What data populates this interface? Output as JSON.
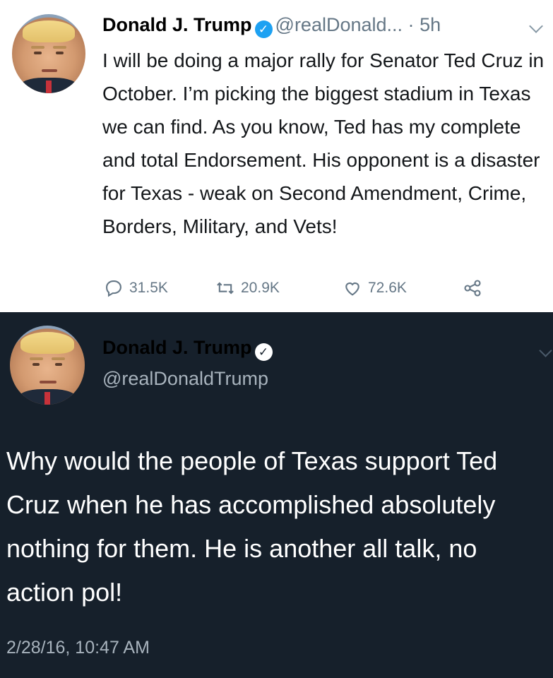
{
  "tweet1": {
    "author_name": "Donald J. Trump",
    "handle": "@realDonald...",
    "separator": "·",
    "time_ago": "5h",
    "text": "I will be doing a major rally for Senator Ted Cruz in October. I’m picking the biggest stadium in Texas we can find. As you know, Ted has my complete and total Endorsement. His opponent is a disaster for Texas - weak on Second Amendment, Crime, Borders, Military, and Vets!",
    "reply_count": "31.5K",
    "retweet_count": "20.9K",
    "like_count": "72.6K",
    "icons": [
      "reply-icon",
      "retweet-icon",
      "like-icon",
      "share-icon",
      "verified-icon",
      "chevron-down-icon"
    ],
    "colors": {
      "background": "#ffffff",
      "text": "#14171a",
      "muted": "#657786",
      "verified": "#1da1f2"
    }
  },
  "tweet2": {
    "author_name": "Donald J. Trump",
    "handle": "@realDonaldTrump",
    "text": "Why would the people of Texas support Ted Cruz when he has accomplished absolutely nothing for them. He is another all talk, no action pol!",
    "timestamp": "2/28/16, 10:47 AM",
    "colors": {
      "background": "#16202b",
      "text": "#ffffff",
      "muted": "#a8b3bd"
    }
  }
}
